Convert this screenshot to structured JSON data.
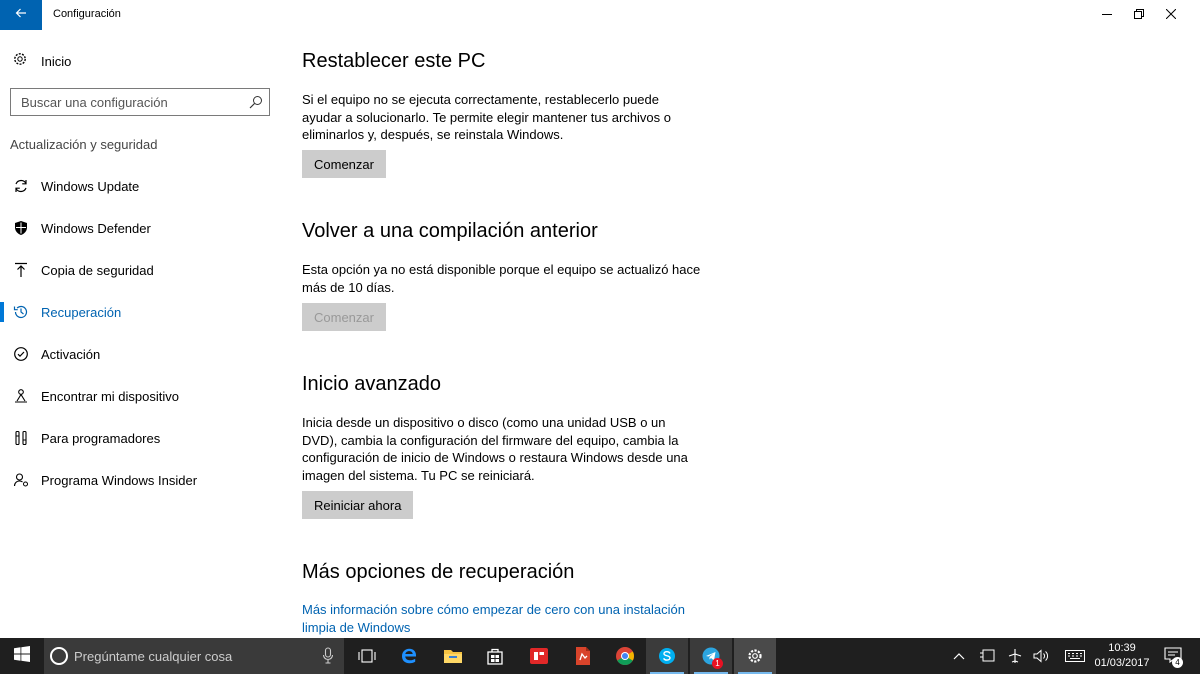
{
  "window": {
    "title": "Configuración",
    "back_icon": "arrow-left-icon",
    "minimize_icon": "minimize-icon",
    "maximize_icon": "restore-icon",
    "close_icon": "close-icon",
    "accent": "#0063b1"
  },
  "sidebar": {
    "home_label": "Inicio",
    "search_placeholder": "Buscar una configuración",
    "group_title": "Actualización y seguridad",
    "items": [
      {
        "label": "Windows Update",
        "icon": "sync-icon"
      },
      {
        "label": "Windows Defender",
        "icon": "shield-icon"
      },
      {
        "label": "Copia de seguridad",
        "icon": "upload-arrow-icon"
      },
      {
        "label": "Recuperación",
        "icon": "history-icon",
        "active": true
      },
      {
        "label": "Activación",
        "icon": "checkmark-circle-icon"
      },
      {
        "label": "Encontrar mi dispositivo",
        "icon": "person-location-icon"
      },
      {
        "label": "Para programadores",
        "icon": "developer-tools-icon"
      },
      {
        "label": "Programa Windows Insider",
        "icon": "insider-person-icon"
      }
    ]
  },
  "main": {
    "reset": {
      "heading": "Restablecer este PC",
      "description": "Si el equipo no se ejecuta correctamente, restablecerlo puede ayudar a solucionarlo. Te permite elegir mantener tus archivos o eliminarlos y, después, se reinstala Windows.",
      "button": "Comenzar"
    },
    "rollback": {
      "heading": "Volver a una compilación anterior",
      "description": "Esta opción ya no está disponible porque el equipo se actualizó hace más de 10 días.",
      "button": "Comenzar",
      "button_disabled": true
    },
    "advanced": {
      "heading": "Inicio avanzado",
      "description": "Inicia desde un dispositivo o disco (como una unidad USB o un DVD), cambia la configuración del firmware del equipo, cambia la configuración de inicio de Windows o restaura Windows desde una imagen del sistema. Tu PC se reiniciará.",
      "button": "Reiniciar ahora"
    },
    "more": {
      "heading": "Más opciones de recuperación",
      "link": "Más información sobre cómo empezar de cero con una instalación limpia de Windows"
    }
  },
  "taskbar": {
    "search_placeholder": "Pregúntame cualquier cosa",
    "apps": [
      "task-view-icon",
      "edge-icon",
      "file-explorer-icon",
      "store-icon",
      "flipboard-icon",
      "pdf-app-icon",
      "chrome-icon",
      "skype-icon",
      "telegram-icon",
      "settings-gear-icon"
    ],
    "telegram_badge": "1",
    "tray_icons": [
      "chevron-up-icon",
      "tablet-mode-icon",
      "airplane-mode-icon",
      "volume-icon",
      "keyboard-icon"
    ],
    "time": "10:39",
    "date": "01/03/2017",
    "notifications_count": "4"
  }
}
